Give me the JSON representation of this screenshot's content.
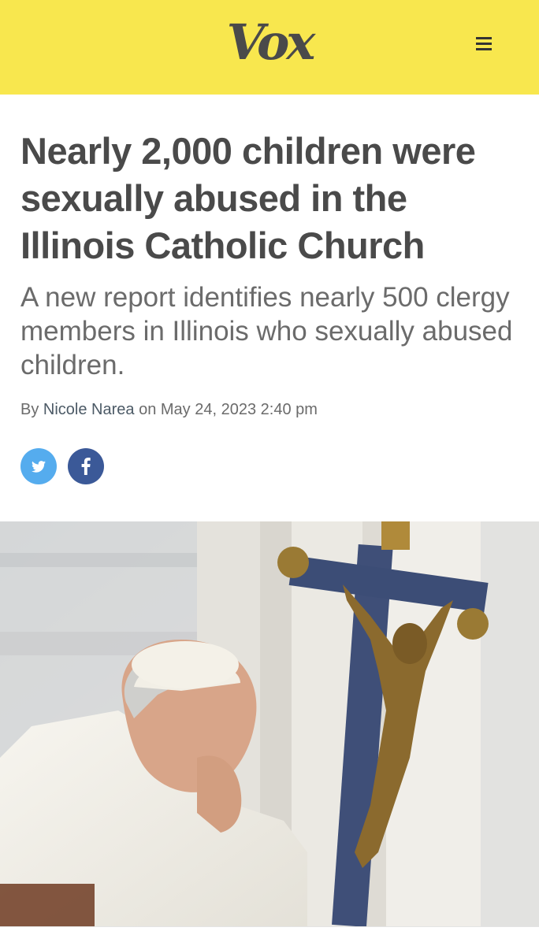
{
  "header": {
    "logo": "Vox",
    "background_color": "#f8e74e",
    "menu_icon": "hamburger-menu-icon"
  },
  "article": {
    "headline": "Nearly 2,000 children were sexually abused in the Illinois Catholic Church",
    "dek": "A new report identifies nearly 500 clergy members in Illinois who sexually abused children.",
    "byline": {
      "prefix": "By",
      "author": "Nicole Narea",
      "date_prefix": "on",
      "date": "May 24, 2023 2:40 pm"
    },
    "share": {
      "twitter_icon": "twitter-icon",
      "facebook_icon": "facebook-icon",
      "twitter_color": "#55acee",
      "facebook_color": "#3b5998"
    }
  }
}
